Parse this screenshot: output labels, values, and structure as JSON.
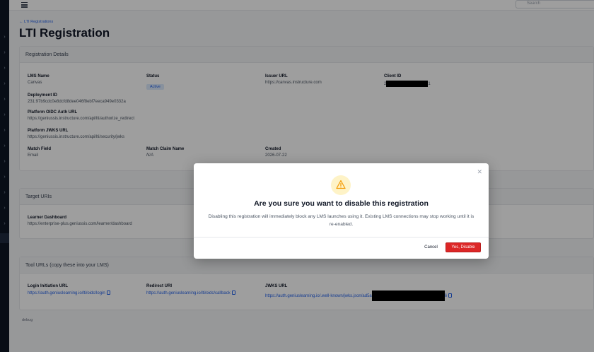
{
  "search": {
    "placeholder": "Search"
  },
  "breadcrumb": {
    "back_label": "← LTI Registrations"
  },
  "page": {
    "title": "LTI Registration"
  },
  "registration_details": {
    "header": "Registration Details",
    "lms_name": {
      "label": "LMS Name",
      "value": "Canvas"
    },
    "status": {
      "label": "Status",
      "value": "Active"
    },
    "issuer_url": {
      "label": "Issuer URL",
      "value": "https://canvas.instructure.com"
    },
    "client_id": {
      "label": "Client ID",
      "prefix": "2",
      "suffix": "1"
    },
    "deployment_id": {
      "label": "Deployment ID",
      "value": "231:97b9cdc0e8dcfd8dee046f8ebf7eeca949e0332a"
    },
    "oidc_auth_url": {
      "label": "Platform OIDC Auth URL",
      "value": "https://geniussis.instructure.com/api/lti/authorize_redirect"
    },
    "jwks_url": {
      "label": "Platform JWKS URL",
      "value": "https://geniussis.instructure.com/api/lti/security/jwks"
    },
    "match_field": {
      "label": "Match Field",
      "value": "Email"
    },
    "match_claim_name": {
      "label": "Match Claim Name",
      "value": "N/A"
    },
    "created": {
      "label": "Created",
      "value": "2026-07-22"
    }
  },
  "target_uris": {
    "header": "Target URIs",
    "learner_dashboard": {
      "label": "Learner Dashboard",
      "value": "https://enterprise-plus.geniussis.com/learner/dashboard"
    }
  },
  "tool_urls": {
    "header": "Tool URLs (copy these into your LMS)",
    "login_initiation": {
      "label": "Login Initiation URL",
      "value": "https://auth.geniuslearning.io/lti/oidc/login"
    },
    "redirect_uri": {
      "label": "Redirect URI",
      "value": "https://auth.geniuslearning.io/lti/oidc/callback"
    },
    "jwks": {
      "label": "JWKS URL",
      "prefix": "https://auth.geniuslearning.io/.well-known/jwks.json/ad5a",
      "suffix": "6"
    }
  },
  "debug": {
    "label": "debug"
  },
  "modal": {
    "title": "Are you sure you want to disable this registration",
    "body": "Disabling this registration will immediately block any LMS launches using it. Existing LMS connections may stop working until it is re-enabled.",
    "cancel_label": "Cancel",
    "confirm_label": "Yes, Disable",
    "warning_color": "#f59e0b",
    "danger_color": "#dc2626"
  }
}
